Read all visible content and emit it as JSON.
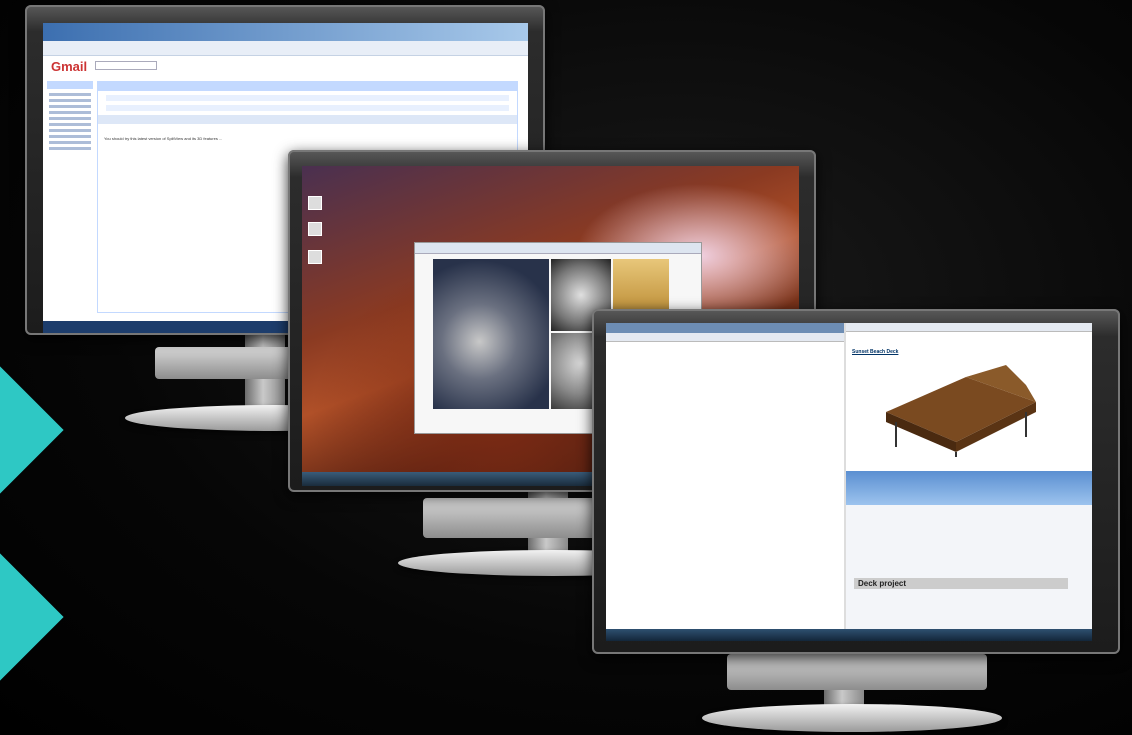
{
  "scene": {
    "accent_color": "#2ec8c4",
    "monitors": [
      {
        "id": "gmail-monitor",
        "content": "Gmail compose window"
      },
      {
        "id": "desktop-monitor",
        "content": "Desktop with photo viewer showing fasteners"
      },
      {
        "id": "split-monitor",
        "content": "Split screen with text editor and deck design page"
      }
    ]
  },
  "gmail": {
    "logo": "Gmail",
    "message_preview": "You should try this latest version of SplitView and its 3D features ..."
  },
  "deck_page": {
    "title": "Sunset Beach Deck",
    "heading": "Deck project"
  }
}
